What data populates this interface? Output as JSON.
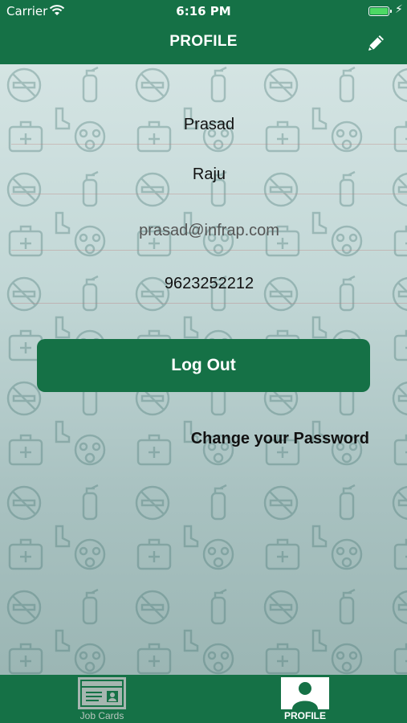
{
  "status_bar": {
    "carrier": "Carrier",
    "time": "6:16 PM",
    "battery_color": "#4cd964"
  },
  "nav": {
    "title": "PROFILE",
    "edit_icon": "pencil-icon"
  },
  "profile": {
    "first_name": "Prasad",
    "last_name": "Raju",
    "email": "prasad@infrap.com",
    "phone": "9623252212"
  },
  "actions": {
    "logout_label": "Log Out",
    "change_password_label": "Change your Password"
  },
  "tabs": [
    {
      "label": "Job Cards",
      "icon": "id-card-icon",
      "selected": false
    },
    {
      "label": "PROFILE",
      "icon": "person-icon",
      "selected": true
    }
  ],
  "colors": {
    "primary": "#157146",
    "background": "#c9dcdb"
  }
}
